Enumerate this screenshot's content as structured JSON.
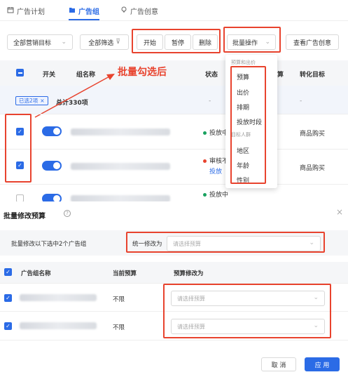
{
  "tabs": [
    {
      "label": "广告计划",
      "icon": "calendar-icon"
    },
    {
      "label": "广告组",
      "icon": "folder-icon"
    },
    {
      "label": "广告创意",
      "icon": "lightbulb-icon"
    }
  ],
  "toolbar": {
    "marketing_goal": "全部营销目标",
    "filter": "全部筛选",
    "start": "开始",
    "pause": "暂停",
    "delete": "删除",
    "bulk_ops": "批量操作",
    "view_creative": "查看广告创意"
  },
  "table": {
    "headers": {
      "switch": "开关",
      "name": "组名称",
      "status": "状态",
      "budget_partial": "算",
      "conversion": "转化目标"
    },
    "selected_badge": "已选2项",
    "selected_badge_close": "×",
    "total_label": "总计330项",
    "dash": "-",
    "rows": [
      {
        "status": "投放中",
        "status_color": "#19a15f",
        "conversion": "商品购买"
      },
      {
        "status": "审核不",
        "status2": "投放",
        "status_color": "#e8432e",
        "conversion": "商品购买"
      },
      {
        "status": "投放中",
        "status_color": "#19a15f"
      }
    ]
  },
  "dropdown": {
    "group1": "预算和出价",
    "items1": [
      "预算",
      "出价",
      "排期",
      "投放时段"
    ],
    "group2": "目标人群",
    "items2": [
      "地区",
      "年龄",
      "性别"
    ]
  },
  "annotation": "批量勾选后",
  "dialog": {
    "title": "批量修改预算",
    "help_icon": "question-circle-icon",
    "close": "×",
    "info": "批量修改以下选中2个广告组",
    "unify_label": "统一修改为",
    "unify_placeholder": "请选择预算",
    "headers": {
      "name": "广告组名称",
      "current": "当前预算",
      "change": "预算修改为"
    },
    "rows": [
      {
        "current": "不限",
        "placeholder": "请选择预算"
      },
      {
        "current": "不限",
        "placeholder": "请选择预算"
      }
    ],
    "cancel": "取 消",
    "apply": "应 用"
  },
  "colors": {
    "primary": "#2b6be6",
    "annotation": "#e8432e"
  }
}
